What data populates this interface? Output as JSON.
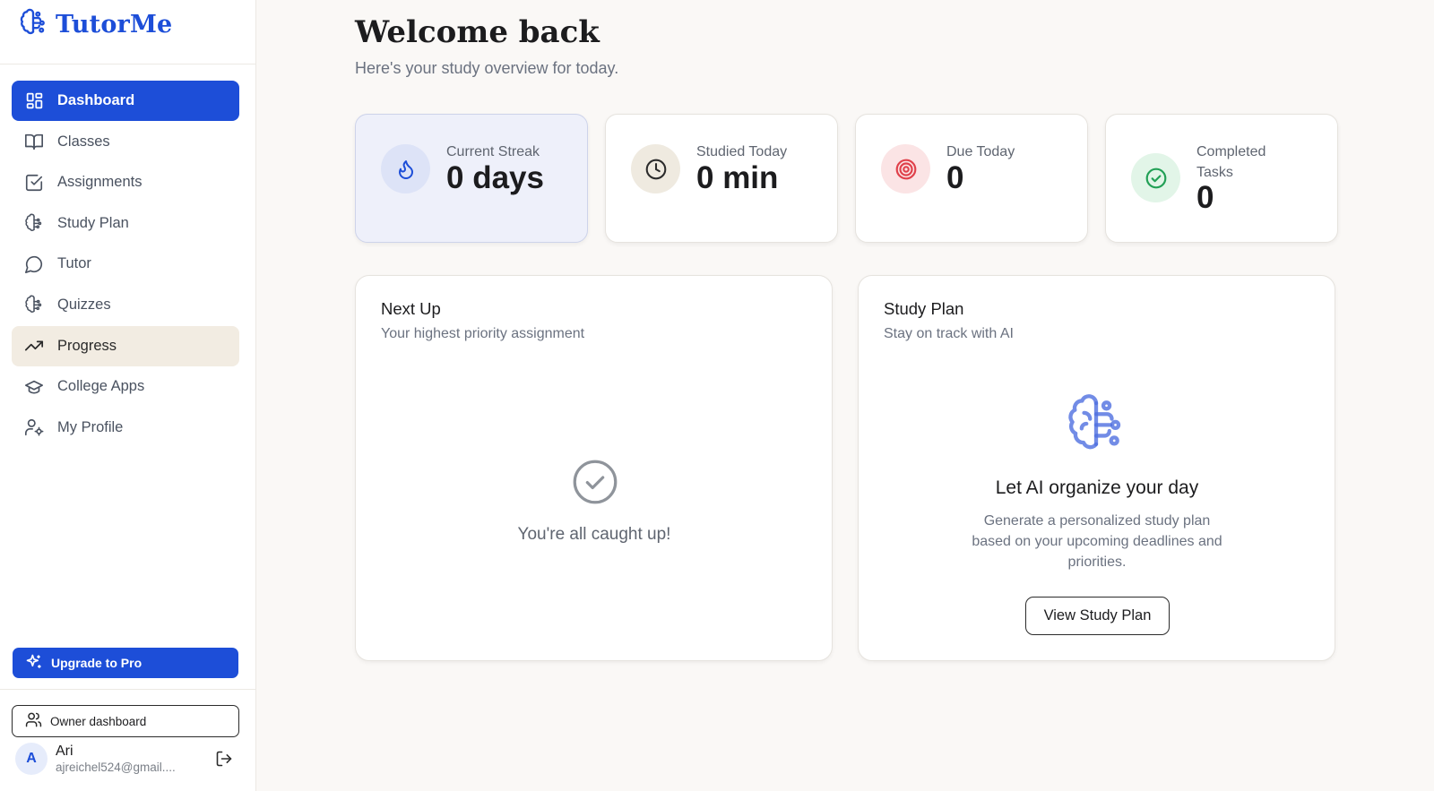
{
  "brand": {
    "name": "TutorMe",
    "logo_icon": "brain-circuit-icon",
    "accent": "#1d4ed8"
  },
  "sidebar": {
    "items": [
      {
        "label": "Dashboard",
        "icon": "dashboard-grid-icon",
        "state": "active"
      },
      {
        "label": "Classes",
        "icon": "book-open-icon",
        "state": "normal"
      },
      {
        "label": "Assignments",
        "icon": "checkbox-icon",
        "state": "normal"
      },
      {
        "label": "Study Plan",
        "icon": "brain-icon",
        "state": "normal"
      },
      {
        "label": "Tutor",
        "icon": "chat-bubble-icon",
        "state": "normal"
      },
      {
        "label": "Quizzes",
        "icon": "brain-icon",
        "state": "normal"
      },
      {
        "label": "Progress",
        "icon": "trending-up-icon",
        "state": "hover"
      },
      {
        "label": "College Apps",
        "icon": "graduation-cap-icon",
        "state": "normal"
      },
      {
        "label": "My Profile",
        "icon": "user-cog-icon",
        "state": "normal"
      }
    ],
    "upgrade_label": "Upgrade to Pro",
    "owner_label": "Owner dashboard",
    "user": {
      "initial": "A",
      "name": "Ari",
      "email": "ajreichel524@gmail...."
    }
  },
  "main": {
    "title": "Welcome back",
    "subtitle": "Here's your study overview for today.",
    "stats": [
      {
        "label": "Current Streak",
        "value": "0 days",
        "icon": "flame-icon",
        "color": "#1d4ed8"
      },
      {
        "label": "Studied Today",
        "value": "0 min",
        "icon": "clock-icon",
        "color": "#2b2b2b"
      },
      {
        "label": "Due Today",
        "value": "0",
        "icon": "target-icon",
        "color": "#e0414b"
      },
      {
        "label": "Completed Tasks",
        "value": "0",
        "icon": "check-circle-icon",
        "color": "#22a056"
      }
    ],
    "next_up": {
      "title": "Next Up",
      "subtitle": "Your highest priority assignment",
      "empty_text": "You're all caught up!"
    },
    "study_plan": {
      "title": "Study Plan",
      "subtitle": "Stay on track with AI",
      "heading": "Let AI organize your day",
      "description": "Generate a personalized study plan based on your upcoming deadlines and priorities.",
      "button_label": "View Study Plan"
    }
  }
}
